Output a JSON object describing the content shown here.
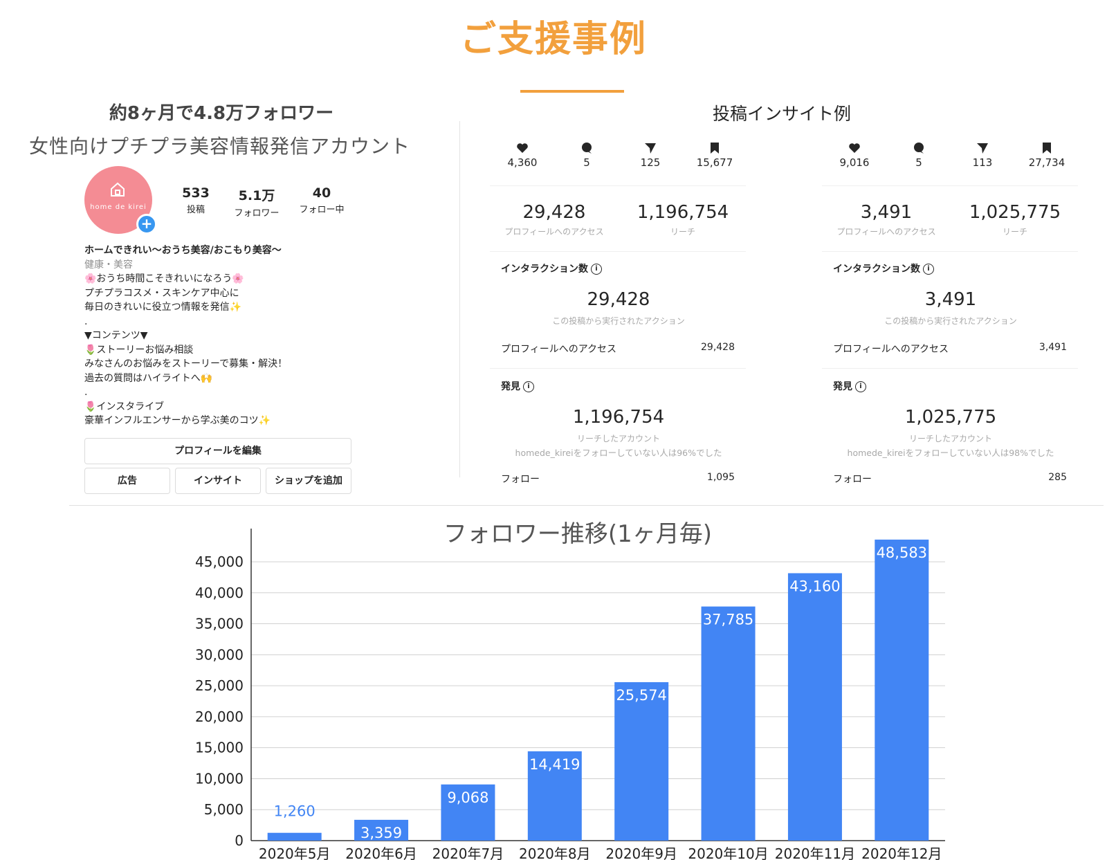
{
  "page": {
    "title": "ご支援事例"
  },
  "profile": {
    "headline": "約8ヶ月で4.8万フォロワー",
    "subtitle": "女性向けプチプラ美容情報発信アカウント",
    "avatar_brand": "home de kirei",
    "stats": [
      {
        "value": "533",
        "label": "投稿"
      },
      {
        "value": "5.1万",
        "label": "フォロワー"
      },
      {
        "value": "40",
        "label": "フォロー中"
      }
    ],
    "bio": {
      "name": "ホームできれい〜おうち美容/おこもり美容〜",
      "category": "健康・美容",
      "lines": [
        "🌸おうち時間こそきれいになろう🌸",
        "プチプラコスメ・スキンケア中心に",
        "毎日のきれいに役立つ情報を発信✨",
        ".",
        "▼コンテンツ▼",
        "🌷ストーリーお悩み相談",
        "みなさんのお悩みをストーリーで募集・解決！",
        "過去の質問はハイライトへ🙌",
        ".",
        "🌷インスタライブ",
        "豪華インフルエンサーから学ぶ美のコツ✨"
      ]
    },
    "buttons": {
      "edit": "プロフィールを編集",
      "ads": "広告",
      "insights": "インサイト",
      "shop": "ショップを追加"
    }
  },
  "insights": {
    "title": "投稿インサイト例",
    "icon_names": [
      "heart-icon",
      "comment-icon",
      "share-icon",
      "bookmark-icon"
    ],
    "panels": [
      {
        "icons": [
          "4,360",
          "5",
          "125",
          "15,677"
        ],
        "profile_access": "29,428",
        "profile_access_label": "プロフィールへのアクセス",
        "reach": "1,196,754",
        "reach_label": "リーチ",
        "interaction_title": "インタラクション数",
        "interaction_value": "29,428",
        "interaction_caption": "この投稿から実行されたアクション",
        "interaction_row_label": "プロフィールへのアクセス",
        "interaction_row_value": "29,428",
        "discovery_title": "発見",
        "discovery_value": "1,196,754",
        "discovery_caption1": "リーチしたアカウント",
        "discovery_caption2": "homede_kireiをフォローしていない人は96%でした",
        "follow_label": "フォロー",
        "follow_value": "1,095"
      },
      {
        "icons": [
          "9,016",
          "5",
          "113",
          "27,734"
        ],
        "profile_access": "3,491",
        "profile_access_label": "プロフィールへのアクセス",
        "reach": "1,025,775",
        "reach_label": "リーチ",
        "interaction_title": "インタラクション数",
        "interaction_value": "3,491",
        "interaction_caption": "この投稿から実行されたアクション",
        "interaction_row_label": "プロフィールへのアクセス",
        "interaction_row_value": "3,491",
        "discovery_title": "発見",
        "discovery_value": "1,025,775",
        "discovery_caption1": "リーチしたアカウント",
        "discovery_caption2": "homede_kireiをフォローしていない人は98%でした",
        "follow_label": "フォロー",
        "follow_value": "285"
      }
    ]
  },
  "chart_data": {
    "type": "bar",
    "title": "フォロワー推移(1ヶ月毎)",
    "categories": [
      "2020年5月",
      "2020年6月",
      "2020年7月",
      "2020年8月",
      "2020年9月",
      "2020年10月",
      "2020年11月",
      "2020年12月"
    ],
    "values": [
      1260,
      3359,
      9068,
      14419,
      25574,
      37785,
      43160,
      48583
    ],
    "value_labels": [
      "1,260",
      "3,359",
      "9,068",
      "14,419",
      "25,574",
      "37,785",
      "43,160",
      "48,583"
    ],
    "yticks": [
      "0",
      "5,000",
      "10,000",
      "15,000",
      "20,000",
      "25,000",
      "30,000",
      "35,000",
      "40,000",
      "45,000"
    ],
    "ylim": [
      0,
      50000
    ],
    "grid": true,
    "bar_color": "#4285f4"
  }
}
